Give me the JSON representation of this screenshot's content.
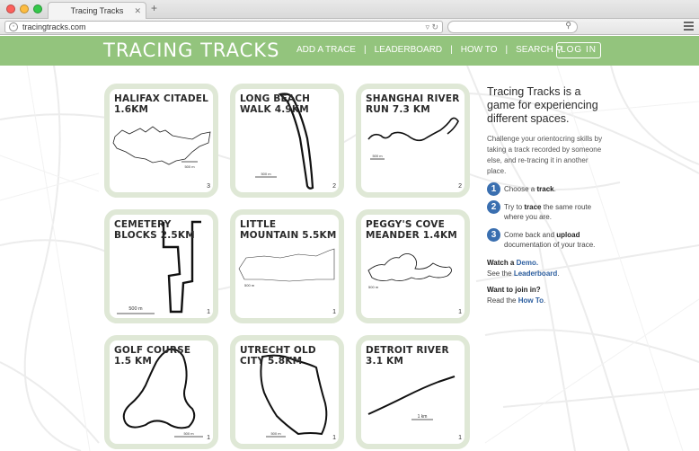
{
  "browser": {
    "tab_title": "Tracing Tracks",
    "url": "tracingtracks.com"
  },
  "header": {
    "logo": "TRACING TRACKS",
    "nav": [
      "ADD A TRACE",
      "LEADERBOARD",
      "HOW TO"
    ],
    "search_label": "SEARCH",
    "login_label": "LOG IN",
    "accent": "#93c47d"
  },
  "tracks": [
    {
      "title": "HALIFAX CITADEL 1.6KM",
      "count": "3",
      "scale": "500 m"
    },
    {
      "title": "LONG BEACH WALK 4.9KM",
      "count": "2",
      "scale": "500 m"
    },
    {
      "title": "SHANGHAI RIVER RUN 7.3 KM",
      "count": "2",
      "scale": "500 m"
    },
    {
      "title": "CEMETERY BLOCKS 2.5KM",
      "count": "1",
      "scale": "500 m"
    },
    {
      "title": "LITTLE MOUNTAIN 5.5KM",
      "count": "1",
      "scale": "500 m"
    },
    {
      "title": "PEGGY'S COVE MEANDER 1.4KM",
      "count": "1",
      "scale": "500 m"
    },
    {
      "title": "GOLF COURSE 1.5 KM",
      "count": "1",
      "scale": "500 m"
    },
    {
      "title": "UTRECHT OLD CITY 5.8KM",
      "count": "1",
      "scale": "500 m"
    },
    {
      "title": "DETROIT RIVER 3.1 KM",
      "count": "1",
      "scale": "1 km"
    }
  ],
  "sidebar": {
    "heading": "Tracing Tracks is a game for experiencing different spaces.",
    "intro": "Challenge your orientocring skills by taking a track recorded by someone else, and re-tracing it in another place.",
    "steps": [
      {
        "num": "1",
        "pre": "Choose a ",
        "bold": "track",
        "post": "."
      },
      {
        "num": "2",
        "pre": "Try to ",
        "bold": "trace",
        "post": " the same route where you are."
      },
      {
        "num": "3",
        "pre": "Come back and ",
        "bold": "upload",
        "post": " documentation of your trace."
      }
    ],
    "watch_pre": "Watch a ",
    "watch_link": "Demo.",
    "see_pre": "See the ",
    "see_link": "Leaderboard",
    "see_post": ".",
    "join_q": "Want to join in?",
    "read_pre": "Read the ",
    "read_link": "How To",
    "read_post": "."
  }
}
